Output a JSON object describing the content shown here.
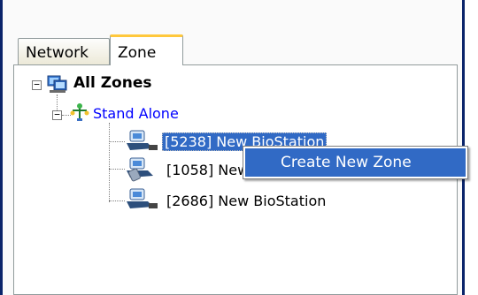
{
  "tabs": [
    {
      "label": "Network",
      "active": false
    },
    {
      "label": "Zone",
      "active": true
    }
  ],
  "tree": {
    "root": {
      "label": "All Zones",
      "expanded": true,
      "icon": "zones-icon"
    },
    "group": {
      "label": "Stand Alone",
      "expanded": true,
      "icon": "standalone-icon"
    },
    "devices": [
      {
        "label": "[5238] New BioStation",
        "selected": true,
        "icon": "biostation-icon"
      },
      {
        "label": "[1058] New BioStation",
        "selected": false,
        "icon": "biostation-icon"
      },
      {
        "label": "[2686] New BioStation",
        "selected": false,
        "icon": "biostation-icon"
      }
    ]
  },
  "context_menu": {
    "items": [
      {
        "label": "Create New Zone",
        "highlighted": true
      }
    ]
  },
  "colors": {
    "frame": "#0a246a",
    "selection": "#316ac5",
    "link_blue": "#0000ff",
    "active_tab_accent": "#ffc83c"
  }
}
